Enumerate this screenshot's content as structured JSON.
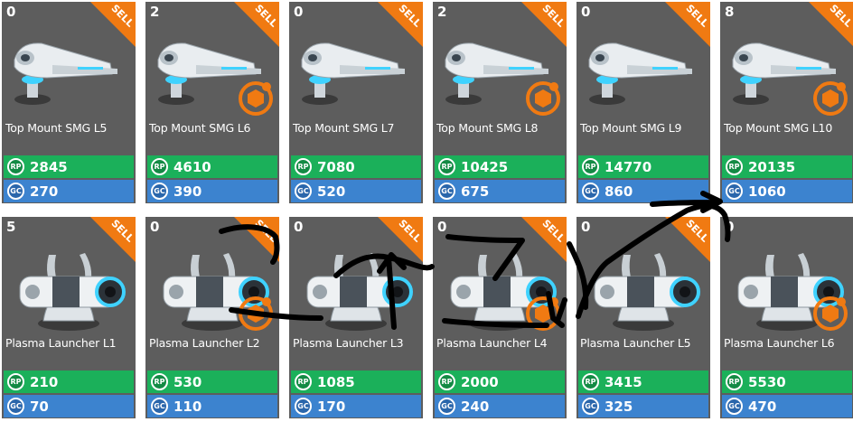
{
  "colors": {
    "card_bg": "#5d5d5d",
    "rp_bar": "#1bb05a",
    "gc_bar": "#3c83cf",
    "sell_banner": "#f07a12",
    "upgrade_badge": "#f07a12"
  },
  "currency": {
    "rp_icon_label": "RP",
    "gc_icon_label": "GC"
  },
  "sell_label": "SELL",
  "rows": [
    {
      "items": [
        {
          "count": "0",
          "name": "Top Mount SMG L5",
          "rp": "2845",
          "gc": "270",
          "sell": true,
          "upgrade": false,
          "icon": "smg-turret-icon"
        },
        {
          "count": "2",
          "name": "Top Mount SMG L6",
          "rp": "4610",
          "gc": "390",
          "sell": true,
          "upgrade": true,
          "icon": "smg-turret-icon"
        },
        {
          "count": "0",
          "name": "Top Mount SMG L7",
          "rp": "7080",
          "gc": "520",
          "sell": true,
          "upgrade": false,
          "icon": "smg-turret-icon"
        },
        {
          "count": "2",
          "name": "Top Mount SMG L8",
          "rp": "10425",
          "gc": "675",
          "sell": true,
          "upgrade": true,
          "icon": "smg-turret-icon"
        },
        {
          "count": "0",
          "name": "Top Mount SMG L9",
          "rp": "14770",
          "gc": "860",
          "sell": true,
          "upgrade": false,
          "icon": "smg-turret-icon"
        },
        {
          "count": "8",
          "name": "Top Mount SMG L10",
          "rp": "20135",
          "gc": "1060",
          "sell": true,
          "upgrade": true,
          "icon": "smg-turret-icon"
        }
      ]
    },
    {
      "items": [
        {
          "count": "5",
          "name": "Plasma Launcher L1",
          "rp": "210",
          "gc": "70",
          "sell": true,
          "upgrade": false,
          "icon": "plasma-launcher-icon"
        },
        {
          "count": "0",
          "name": "Plasma Launcher L2",
          "rp": "530",
          "gc": "110",
          "sell": true,
          "upgrade": true,
          "icon": "plasma-launcher-icon"
        },
        {
          "count": "0",
          "name": "Plasma Launcher L3",
          "rp": "1085",
          "gc": "170",
          "sell": true,
          "upgrade": false,
          "icon": "plasma-launcher-icon"
        },
        {
          "count": "0",
          "name": "Plasma Launcher L4",
          "rp": "2000",
          "gc": "240",
          "sell": true,
          "upgrade": true,
          "icon": "plasma-launcher-icon"
        },
        {
          "count": "0",
          "name": "Plasma Launcher L5",
          "rp": "3415",
          "gc": "325",
          "sell": true,
          "upgrade": false,
          "icon": "plasma-launcher-icon"
        },
        {
          "count": "0",
          "name": "Plasma Launcher L6",
          "rp": "5530",
          "gc": "470",
          "sell": false,
          "upgrade": true,
          "icon": "plasma-launcher-icon"
        }
      ]
    }
  ]
}
